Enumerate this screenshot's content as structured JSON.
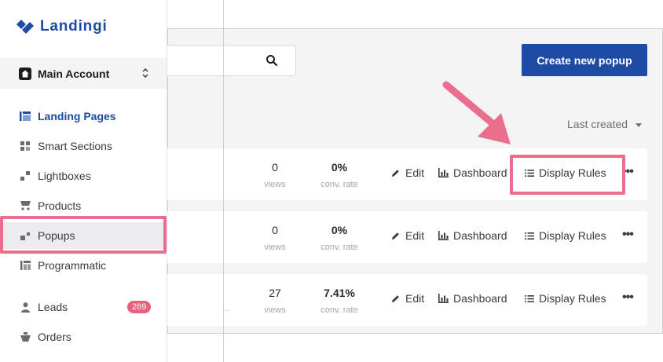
{
  "app": {
    "logo_text": "Landingi"
  },
  "account": {
    "name": "Main Account"
  },
  "sidebar": {
    "items": [
      {
        "label": "Landing Pages"
      },
      {
        "label": "Smart Sections"
      },
      {
        "label": "Lightboxes"
      },
      {
        "label": "Products"
      },
      {
        "label": "Popups"
      },
      {
        "label": "Programmatic"
      },
      {
        "label": "Leads",
        "badge": "269"
      },
      {
        "label": "Orders"
      }
    ]
  },
  "toolbar": {
    "search_placeholder": "",
    "create_label": "Create new popup",
    "sort_label": "Last created"
  },
  "list": {
    "rows": [
      {
        "views": "0",
        "views_label": "views",
        "conv": "0%",
        "conv_label": "conv. rate",
        "truncated": ""
      },
      {
        "views": "0",
        "views_label": "views",
        "conv": "0%",
        "conv_label": "conv. rate",
        "truncated": ""
      },
      {
        "views": "27",
        "views_label": "views",
        "conv": "7.41%",
        "conv_label": "conv. rate",
        "truncated": "..."
      }
    ],
    "actions": {
      "edit": "Edit",
      "dashboard": "Dashboard",
      "rules": "Display Rules",
      "more": "•••"
    }
  },
  "colors": {
    "brand": "#1e4ba3",
    "highlight": "#ea6e8d",
    "badge": "#e7607e"
  },
  "icons": [
    "search-icon",
    "home-icon",
    "chevron-updown-icon",
    "pencil-icon",
    "bar-chart-icon",
    "list-icon",
    "more-icon"
  ]
}
